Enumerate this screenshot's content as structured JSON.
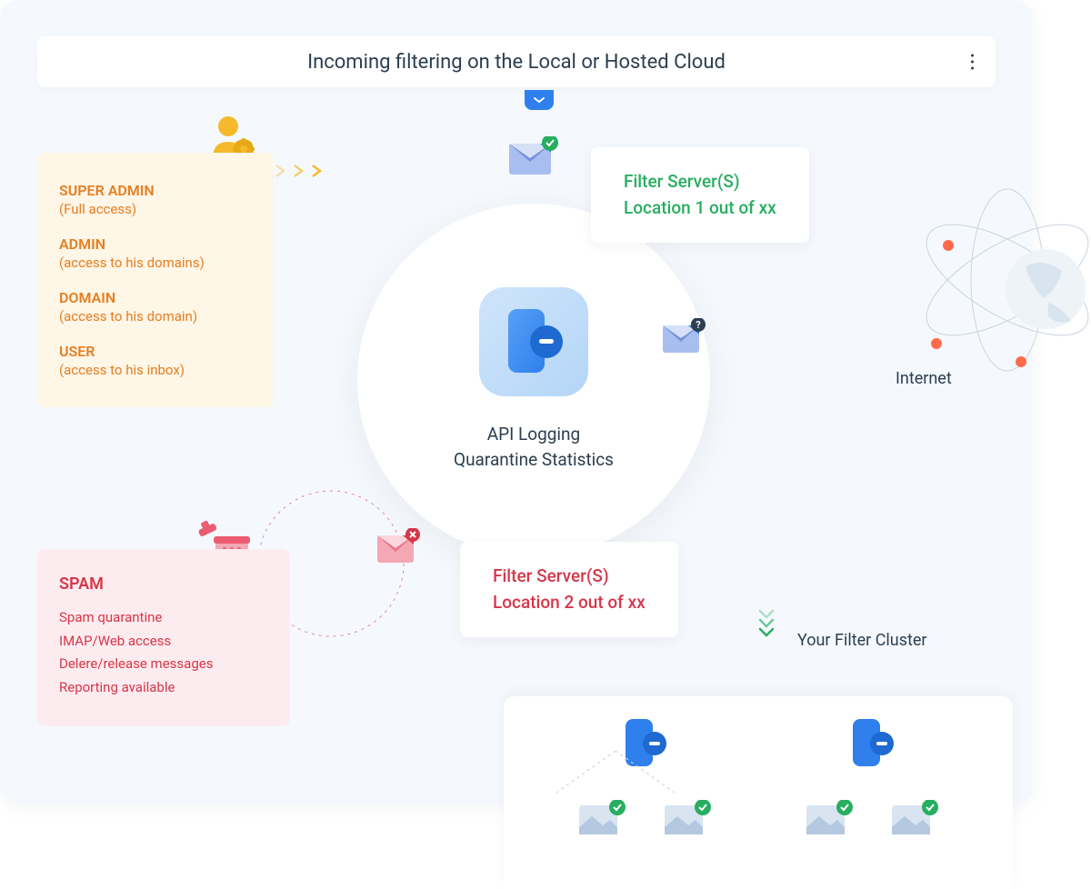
{
  "header": {
    "title": "Incoming filtering on the Local or Hosted Cloud"
  },
  "admin": {
    "roles": [
      {
        "name": "SUPER ADMIN",
        "desc": "(Full access)"
      },
      {
        "name": "ADMIN",
        "desc": "(access to his domains)"
      },
      {
        "name": "DOMAIN",
        "desc": "(access to his domain)"
      },
      {
        "name": "USER",
        "desc": "(access to his inbox)"
      }
    ]
  },
  "center": {
    "line1": "API Logging",
    "line2": "Quarantine Statistics"
  },
  "spam": {
    "title": "SPAM",
    "items": [
      "Spam quarantine",
      "IMAP/Web access",
      "Delere/release messages",
      "Reporting available"
    ]
  },
  "filter1": {
    "l1": "Filter Server(S)",
    "l2": "Location 1 out of xx"
  },
  "filter2": {
    "l1": "Filter Server(S)",
    "l2": "Location 2 out of xx"
  },
  "cluster_label": "Your Filter Cluster",
  "internet": "Internet",
  "colors": {
    "green": "#27ae60",
    "red": "#d63649",
    "orange": "#e67e22",
    "blue": "#2f80ed"
  }
}
